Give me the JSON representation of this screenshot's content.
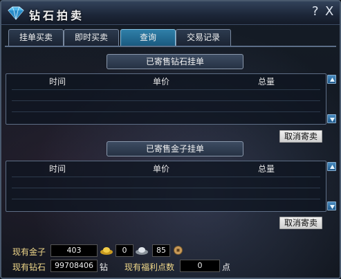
{
  "window": {
    "title": "钻石拍卖",
    "help_label": "?",
    "close_label": "X"
  },
  "tabs": [
    {
      "label": "挂单买卖",
      "active": false
    },
    {
      "label": "即时买卖",
      "active": false
    },
    {
      "label": "查询",
      "active": true
    },
    {
      "label": "交易记录",
      "active": false
    }
  ],
  "diamond_listing": {
    "title": "已寄售钻石挂单",
    "columns": [
      "时间",
      "单价",
      "总量"
    ],
    "rows": [],
    "cancel_label": "取消寄卖"
  },
  "gold_listing": {
    "title": "已寄售金子挂单",
    "columns": [
      "时间",
      "单价",
      "总量"
    ],
    "rows": [],
    "cancel_label": "取消寄卖"
  },
  "wallet": {
    "gold_label": "现有金子",
    "gold_value": "403",
    "silver_value": "0",
    "copper_value": "85",
    "diamond_label": "现有钻石",
    "diamond_value": "99708406",
    "diamond_unit": "钻",
    "points_label": "现有福利点数",
    "points_value": "0",
    "points_unit": "点"
  },
  "colors": {
    "accent": "#1a5a80",
    "label": "#f0d88a",
    "frame": "#4a5a6e"
  }
}
